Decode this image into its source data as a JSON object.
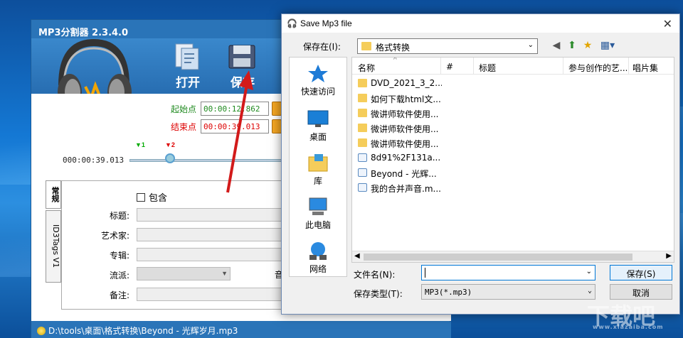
{
  "app": {
    "title": "MP3分割器 2.3.4.0",
    "toolbar": {
      "open_label": "打开",
      "save_label": "保存"
    },
    "start_label": "起始点",
    "start_value": "00:00:12.862",
    "end_label": "结束点",
    "end_value": "00:00:39.013",
    "position_time": "000:00:39.013",
    "marker1": "1",
    "marker2": "2",
    "tabs": {
      "general": "常规",
      "id3": "ID3Tags V1"
    },
    "include_label": "包含",
    "fields": {
      "title": "标题:",
      "artist": "艺术家:",
      "album": "专辑:",
      "genre": "流派:",
      "comment": "备注:"
    },
    "side_char": "音",
    "status_path": "D:\\tools\\桌面\\格式转换\\Beyond - 光辉岁月.mp3"
  },
  "dialog": {
    "title": "Save Mp3 file",
    "save_in_label": "保存在(I):",
    "current_folder": "格式转换",
    "places": [
      {
        "label": "快速访问",
        "icon": "star-icon"
      },
      {
        "label": "桌面",
        "icon": "desktop-icon"
      },
      {
        "label": "库",
        "icon": "library-icon"
      },
      {
        "label": "此电脑",
        "icon": "computer-icon"
      },
      {
        "label": "网络",
        "icon": "network-icon"
      }
    ],
    "columns": {
      "name": "名称",
      "num": "#",
      "title": "标题",
      "artist": "参与创作的艺...",
      "album": "唱片集"
    },
    "files": [
      {
        "name": "DVD_2021_3_2...",
        "type": "folder"
      },
      {
        "name": "如何下载html文...",
        "type": "folder"
      },
      {
        "name": "微讲师软件使用...",
        "type": "folder"
      },
      {
        "name": "微讲师软件使用...",
        "type": "folder"
      },
      {
        "name": "微讲师软件使用...",
        "type": "folder"
      },
      {
        "name": "8d91%2F131a...",
        "type": "audio"
      },
      {
        "name": "Beyond - 光辉...",
        "type": "audio"
      },
      {
        "name": "我的合并声音.m...",
        "type": "audio"
      }
    ],
    "filename_label": "文件名(N):",
    "filename_value": "",
    "filetype_label": "保存类型(T):",
    "filetype_value": "MP3(*.mp3)",
    "save_button": "保存(S)",
    "cancel_button": "取消"
  },
  "watermark": {
    "main": "下载吧",
    "sub": "www.xiazaiba.com"
  }
}
